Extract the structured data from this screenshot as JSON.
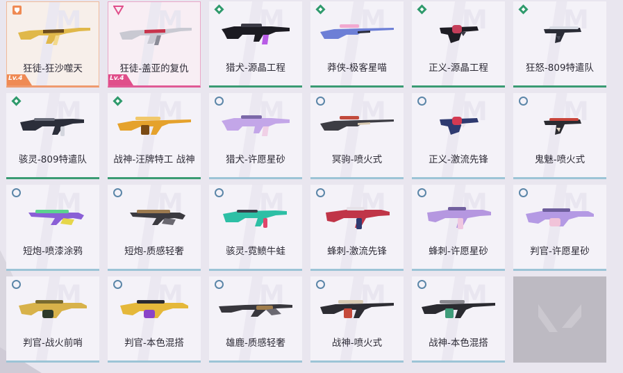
{
  "grid": {
    "cards": [
      {
        "name": "狂徒-狂沙噬天",
        "tier": "orange",
        "level": "Lv.4",
        "gun": "rifle",
        "colors": [
          "#e0b84a",
          "#6b4b1f",
          "#f3d98b"
        ]
      },
      {
        "name": "狂徒-盖亚的复仇",
        "tier": "pink",
        "level": "Lv.4",
        "gun": "rifle",
        "colors": [
          "#c9c9d2",
          "#c8344c",
          "#8a8b96"
        ]
      },
      {
        "name": "猎犬-源晶工程",
        "tier": "green",
        "gun": "bulldog",
        "colors": [
          "#1c1b22",
          "#b85ce6",
          "#3b3a45"
        ]
      },
      {
        "name": "莽侠-极客星喵",
        "tier": "green",
        "gun": "sniper",
        "colors": [
          "#6d7fd6",
          "#f2a9d0",
          "#2a2c3a"
        ]
      },
      {
        "name": "正义-源晶工程",
        "tier": "green",
        "gun": "revolver",
        "colors": [
          "#1e1d24",
          "#c43e5a",
          "#3a3945"
        ]
      },
      {
        "name": "狂怒-809特遣队",
        "tier": "green",
        "gun": "pistol",
        "colors": [
          "#2a2c36",
          "#d8dbe4",
          "#4a4d5a"
        ]
      },
      {
        "name": "骇灵-809特遣队",
        "tier": "green",
        "gun": "smg",
        "colors": [
          "#2b2e3a",
          "#d4d6de",
          "#6a6d7a"
        ]
      },
      {
        "name": "战神-汪牌特工 战神",
        "tier": "green",
        "gun": "lmg",
        "colors": [
          "#e5a22c",
          "#7a4a14",
          "#f1c86a"
        ]
      },
      {
        "name": "猎犬-许愿星砂",
        "tier": "blue",
        "gun": "bulldog",
        "colors": [
          "#c3a6e8",
          "#f0d0e6",
          "#7b68a8"
        ]
      },
      {
        "name": "冥驹-喷火式",
        "tier": "blue",
        "gun": "sniper",
        "colors": [
          "#3d3d44",
          "#c24a3c",
          "#d8c9b0"
        ]
      },
      {
        "name": "正义-激流先锋",
        "tier": "blue",
        "gun": "revolver",
        "colors": [
          "#2e3a70",
          "#d43a52",
          "#e8e3ea"
        ]
      },
      {
        "name": "鬼魅-喷火式",
        "tier": "blue",
        "gun": "pistol",
        "colors": [
          "#2b2b31",
          "#c8443a",
          "#e4d6c2"
        ]
      },
      {
        "name": "短炮-喷漆涂鸦",
        "tier": "blue",
        "gun": "shorty",
        "colors": [
          "#8a5fd6",
          "#5bd38f",
          "#e6d64a"
        ]
      },
      {
        "name": "短炮-质感轻奢",
        "tier": "blue",
        "gun": "shorty",
        "colors": [
          "#3b3a40",
          "#9c7a4f",
          "#6a6870"
        ]
      },
      {
        "name": "骇灵-霓鲼牛蛙",
        "tier": "blue",
        "gun": "smg",
        "colors": [
          "#2dbfa5",
          "#e0466b",
          "#3a3d48"
        ]
      },
      {
        "name": "蜂刺-激流先锋",
        "tier": "blue",
        "gun": "smg2",
        "colors": [
          "#c03548",
          "#2f3a70",
          "#e6e1e8"
        ]
      },
      {
        "name": "蜂刺-许愿星砂",
        "tier": "blue",
        "gun": "smg2",
        "colors": [
          "#b597e0",
          "#efc7e0",
          "#72609f"
        ]
      },
      {
        "name": "判官-许愿星砂",
        "tier": "blue",
        "gun": "judge",
        "colors": [
          "#b49ae4",
          "#f1c3d9",
          "#6e5e9c"
        ]
      },
      {
        "name": "判官-战火前哨",
        "tier": "blue",
        "gun": "judge",
        "colors": [
          "#d8b24a",
          "#2e3a2a",
          "#7a6b2f"
        ]
      },
      {
        "name": "判官-本色混搭",
        "tier": "blue",
        "gun": "judge",
        "colors": [
          "#e5b83a",
          "#8a44c8",
          "#2b2a30"
        ]
      },
      {
        "name": "雄鹿-质感轻奢",
        "tier": "blue",
        "gun": "shotgun",
        "colors": [
          "#38373d",
          "#a07d4c",
          "#6b6972"
        ]
      },
      {
        "name": "战神-喷火式",
        "tier": "blue",
        "gun": "lmg",
        "colors": [
          "#2d2d33",
          "#c54a3b",
          "#d9ccb4"
        ]
      },
      {
        "name": "战神-本色混搭",
        "tier": "blue",
        "gun": "lmg",
        "colors": [
          "#2a2a30",
          "#3f9c7a",
          "#8a8990"
        ]
      }
    ]
  },
  "colors": {
    "tier_orange": "#ef8a54",
    "tier_pink": "#e04e8a",
    "tier_green": "#2f9a6c",
    "tier_blue": "#5b86a8"
  }
}
